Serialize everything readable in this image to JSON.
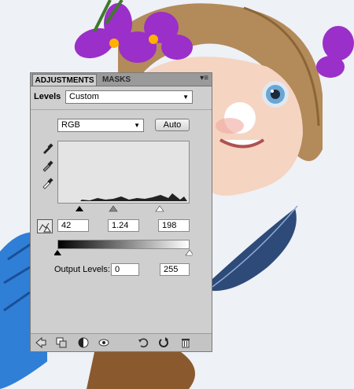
{
  "panel": {
    "tabs": [
      "ADJUSTMENTS",
      "MASKS"
    ],
    "menu_glyph": "▾≡",
    "title": "Levels",
    "preset": "Custom",
    "channel": "RGB",
    "auto_label": "Auto",
    "input_levels": {
      "black": "42",
      "gamma": "1.24",
      "white": "198"
    },
    "output_label": "Output Levels:",
    "output_levels": {
      "black": "0",
      "white": "255"
    }
  },
  "colors": {
    "panel_bg": "#cfcfcf",
    "tab_bar": "#9a9a9a",
    "flower": "#9b2fc9",
    "hair": "#b38a5a",
    "bird_blue": "#2f7fd6"
  },
  "icons": {
    "eyedroppers": [
      "black-point-eyedropper-icon",
      "gray-point-eyedropper-icon",
      "white-point-eyedropper-icon"
    ],
    "bottom": [
      "back-arrow-icon",
      "clip-to-layer-icon",
      "layer-mask-icon",
      "eye-icon",
      "previous-state-icon",
      "reset-icon",
      "trash-icon"
    ]
  }
}
